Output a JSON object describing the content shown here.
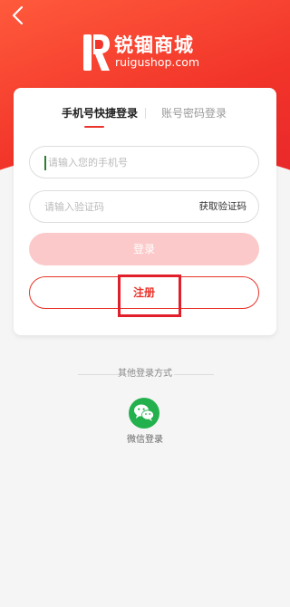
{
  "brand": {
    "name_cn": "锐锢商城",
    "name_en": "ruigushop.com"
  },
  "tabs": [
    {
      "label": "手机号快捷登录",
      "active": true
    },
    {
      "label": "账号密码登录",
      "active": false
    }
  ],
  "form": {
    "phone_placeholder": "请输入您的手机号",
    "code_placeholder": "请输入验证码",
    "get_code_label": "获取验证码",
    "login_label": "登录",
    "register_label": "注册"
  },
  "other_login": {
    "title": "其他登录方式",
    "wechat_label": "微信登录"
  },
  "colors": {
    "accent": "#e8342a",
    "login_disabled": "#fbc9c9",
    "wechat": "#22b14c"
  },
  "icons": [
    "back-icon",
    "ruigu-logo-icon",
    "wechat-icon"
  ]
}
